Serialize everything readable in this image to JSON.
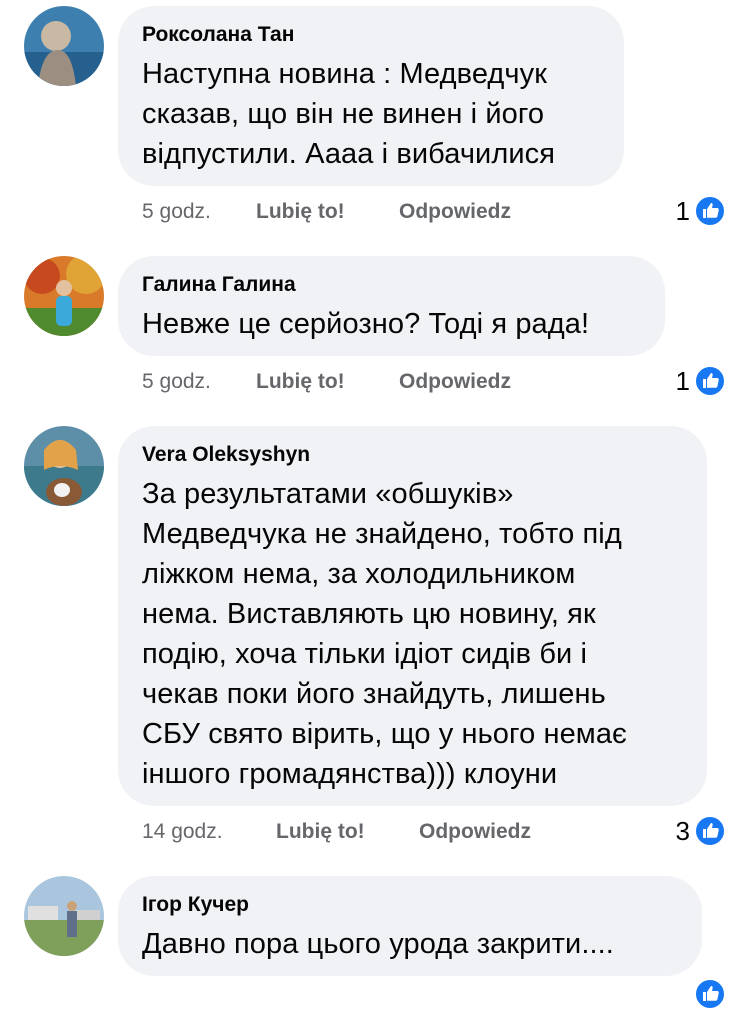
{
  "comments": [
    {
      "author": "Роксолана Тан",
      "text": "Наступна новина : Медведчук\nсказав, що він не винен і його\nвідпустили. Аааа і вибачилися",
      "time": "5 godz.",
      "like_label": "Lubię to!",
      "reply_label": "Odpowiedz",
      "reaction_count": "1",
      "reaction_icon": "like-icon"
    },
    {
      "author": "Галина Галина",
      "text": "Невже це серйозно? Тоді я рада!",
      "time": "5 godz.",
      "like_label": "Lubię to!",
      "reply_label": "Odpowiedz",
      "reaction_count": "1",
      "reaction_icon": "like-icon"
    },
    {
      "author": "Vera Oleksyshyn",
      "text": "За результатами «обшуків»\nМедведчука не знайдено, тобто під\nліжком нема, за холодильником\nнема. Виставляють цю новину, як\nподію, хоча тільки ідіот сидів би і\nчекав поки його знайдуть, лишень\nСБУ свято вірить, що у нього немає\nіншого громадянства))) клоуни",
      "time": "14 godz.",
      "like_label": "Lubię to!",
      "reply_label": "Odpowiedz",
      "reaction_count": "3",
      "reaction_icon": "like-icon"
    },
    {
      "author": "Ігор Кучер",
      "text": "Давно пора цього урода закрити....",
      "reaction_icon": "like-icon"
    }
  ],
  "colors": {
    "bubble": "#f0f2f5",
    "meta_text": "#65676b",
    "like_blue": "#1877f2"
  }
}
